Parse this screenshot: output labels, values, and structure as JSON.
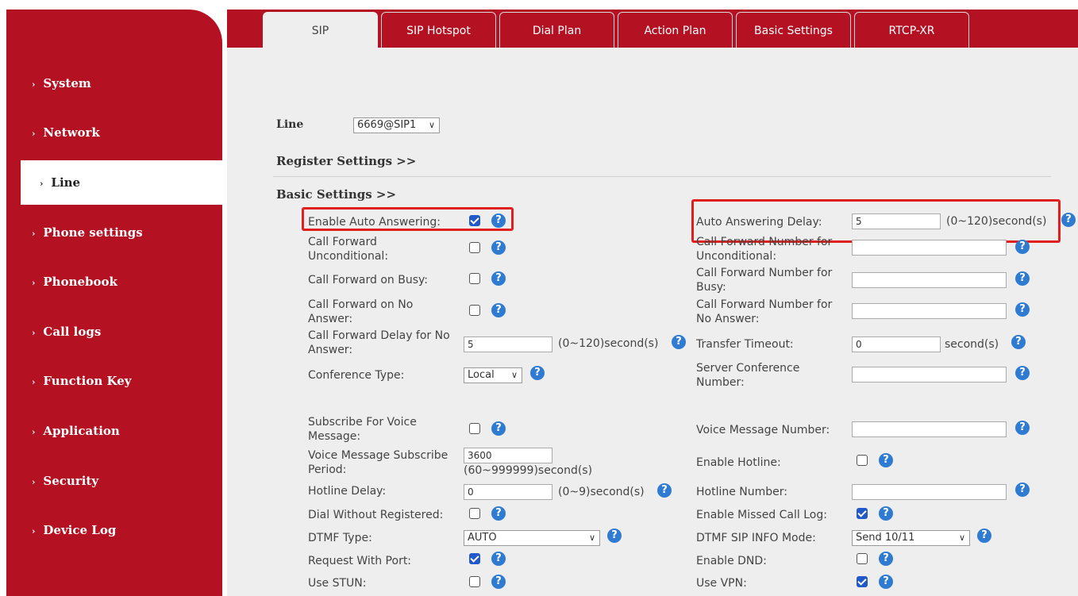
{
  "sidebar": {
    "items": [
      {
        "label": "System"
      },
      {
        "label": "Network"
      },
      {
        "label": "Line"
      },
      {
        "label": "Phone settings"
      },
      {
        "label": "Phonebook"
      },
      {
        "label": "Call logs"
      },
      {
        "label": "Function Key"
      },
      {
        "label": "Application"
      },
      {
        "label": "Security"
      },
      {
        "label": "Device Log"
      }
    ],
    "active": "Line"
  },
  "tabs": [
    {
      "label": "SIP"
    },
    {
      "label": "SIP Hotspot"
    },
    {
      "label": "Dial Plan"
    },
    {
      "label": "Action Plan"
    },
    {
      "label": "Basic Settings"
    },
    {
      "label": "RTCP-XR"
    }
  ],
  "line": {
    "label": "Line",
    "value": "6669@SIP1"
  },
  "sections": {
    "register": "Register Settings >>",
    "basic": "Basic Settings >>"
  },
  "left": {
    "enable_auto_answering": {
      "label": "Enable Auto Answering:",
      "checked": true
    },
    "cf_unconditional": {
      "label1": "Call Forward",
      "label2": "Unconditional:",
      "checked": false
    },
    "cf_busy": {
      "label": "Call Forward on Busy:",
      "checked": false
    },
    "cf_no_answer": {
      "label1": "Call Forward on No",
      "label2": "Answer:",
      "checked": false
    },
    "cf_delay": {
      "label1": "Call Forward Delay for No",
      "label2": "Answer:",
      "value": "5",
      "unit": "(0~120)second(s)"
    },
    "conference_type": {
      "label": "Conference Type:",
      "value": "Local"
    },
    "subscribe_voice": {
      "label1": "Subscribe For Voice",
      "label2": "Message:",
      "checked": false
    },
    "vm_subscribe_period": {
      "label1": "Voice Message Subscribe",
      "label2": "Period:",
      "value": "3600",
      "unit": "(60~999999)second(s)"
    },
    "hotline_delay": {
      "label": "Hotline Delay:",
      "value": "0",
      "unit": "(0~9)second(s)"
    },
    "dial_without_registered": {
      "label": "Dial Without Registered:",
      "checked": false
    },
    "dtmf_type": {
      "label": "DTMF Type:",
      "value": "AUTO"
    },
    "request_with_port": {
      "label": "Request With Port:",
      "checked": true
    },
    "use_stun": {
      "label": "Use STUN:",
      "checked": false
    }
  },
  "right": {
    "auto_answering_delay": {
      "label": "Auto Answering Delay:",
      "value": "5",
      "unit": "(0~120)second(s)"
    },
    "cf_number_unconditional": {
      "label1": "Call Forward Number for",
      "label2": "Unconditional:",
      "value": ""
    },
    "cf_number_busy": {
      "label1": "Call Forward Number for",
      "label2": "Busy:",
      "value": ""
    },
    "cf_number_no_answer": {
      "label1": "Call Forward Number for",
      "label2": "No Answer:",
      "value": ""
    },
    "transfer_timeout": {
      "label": "Transfer Timeout:",
      "value": "0",
      "unit": "second(s)"
    },
    "server_conference": {
      "label1": "Server Conference",
      "label2": "Number:",
      "value": ""
    },
    "voice_message_number": {
      "label": "Voice Message Number:",
      "value": ""
    },
    "enable_hotline": {
      "label": "Enable Hotline:",
      "checked": false
    },
    "hotline_number": {
      "label": "Hotline Number:",
      "value": ""
    },
    "enable_missed_call_log": {
      "label": "Enable Missed Call Log:",
      "checked": true
    },
    "dtmf_sip_info_mode": {
      "label": "DTMF SIP INFO Mode:",
      "value": "Send 10/11"
    },
    "enable_dnd": {
      "label": "Enable DND:",
      "checked": false
    },
    "use_vpn": {
      "label": "Use VPN:",
      "checked": true
    }
  },
  "icons": {
    "help": "?",
    "chevron": "›",
    "dropdown": "∨"
  },
  "colors": {
    "brand": "#b41123",
    "highlight": "#e0201e",
    "checkbox": "#2159c8",
    "help": "#2f7bd2"
  }
}
